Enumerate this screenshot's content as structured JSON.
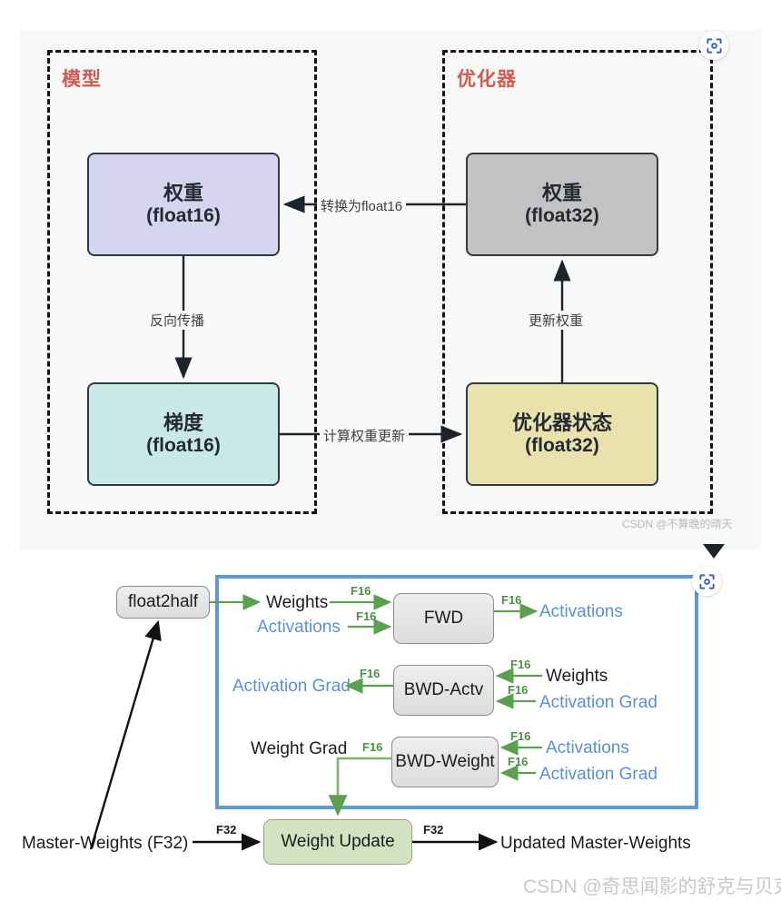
{
  "top_figure": {
    "groups": [
      {
        "name": "model",
        "label": "模型"
      },
      {
        "name": "optimizer",
        "label": "优化器"
      }
    ],
    "nodes": [
      {
        "name": "weights-fp16",
        "title": "权重",
        "subtitle": "(float16)",
        "color": "#d6d4ee"
      },
      {
        "name": "weights-fp32",
        "title": "权重",
        "subtitle": "(float32)",
        "color": "#c3c3c3"
      },
      {
        "name": "gradients-fp16",
        "title": "梯度",
        "subtitle": "(float16)",
        "color": "#c9e9e7"
      },
      {
        "name": "optimizer-state",
        "title": "优化器状态",
        "subtitle": "(float32)",
        "color": "#e9e2ad"
      }
    ],
    "edges": [
      {
        "name": "cast-to-float16",
        "label": "转换为float16"
      },
      {
        "name": "backpropagation",
        "label": "反向传播"
      },
      {
        "name": "compute-update",
        "label": "计算权重更新"
      },
      {
        "name": "update-weights",
        "label": "更新权重"
      }
    ],
    "watermark": "CSDN @不算晚的晴天",
    "label_color": "#cf5b52"
  },
  "bottom_figure": {
    "boxes": [
      {
        "name": "float2half",
        "label": "float2half",
        "style": "gray"
      },
      {
        "name": "fwd",
        "label": "FWD",
        "style": "gray"
      },
      {
        "name": "bwd-actv",
        "label": "BWD-Actv",
        "style": "gray"
      },
      {
        "name": "bwd-weight",
        "label": "BWD-Weight",
        "style": "gray"
      },
      {
        "name": "weight-update",
        "label": "Weight Update",
        "style": "green"
      }
    ],
    "text_nodes": [
      {
        "name": "weights-in",
        "label": "Weights",
        "color": "black"
      },
      {
        "name": "activations-in",
        "label": "Activations",
        "color": "blue"
      },
      {
        "name": "activations-out",
        "label": "Activations",
        "color": "blue"
      },
      {
        "name": "activation-grad-out",
        "label": "Activation Grad",
        "color": "blue"
      },
      {
        "name": "weights-bwd-in",
        "label": "Weights",
        "color": "black"
      },
      {
        "name": "activation-grad-in",
        "label": "Activation Grad",
        "color": "blue"
      },
      {
        "name": "weight-grad-out",
        "label": "Weight Grad",
        "color": "black"
      },
      {
        "name": "activations-bwdw-in",
        "label": "Activations",
        "color": "blue"
      },
      {
        "name": "activation-grad-bwdw",
        "label": "Activation Grad",
        "color": "blue"
      },
      {
        "name": "master-weights",
        "label": "Master-Weights (F32)",
        "color": "black"
      },
      {
        "name": "updated-master-weights",
        "label": "Updated Master-Weights",
        "color": "black"
      }
    ],
    "precision_labels": {
      "f16": "F16",
      "f32": "F32"
    },
    "watermark": "CSDN @奇思闻影的舒克与贝克",
    "colors": {
      "border_blue": "#5b9bd5",
      "arrow_green": "#5aa04e",
      "text_blue": "#5b8fd6",
      "box_green": "#d3e3c1"
    }
  },
  "overlay": {
    "scan_button_top": "scan-icon",
    "scan_button_bottom": "scan-icon",
    "cursor": "cursor-arrow"
  }
}
